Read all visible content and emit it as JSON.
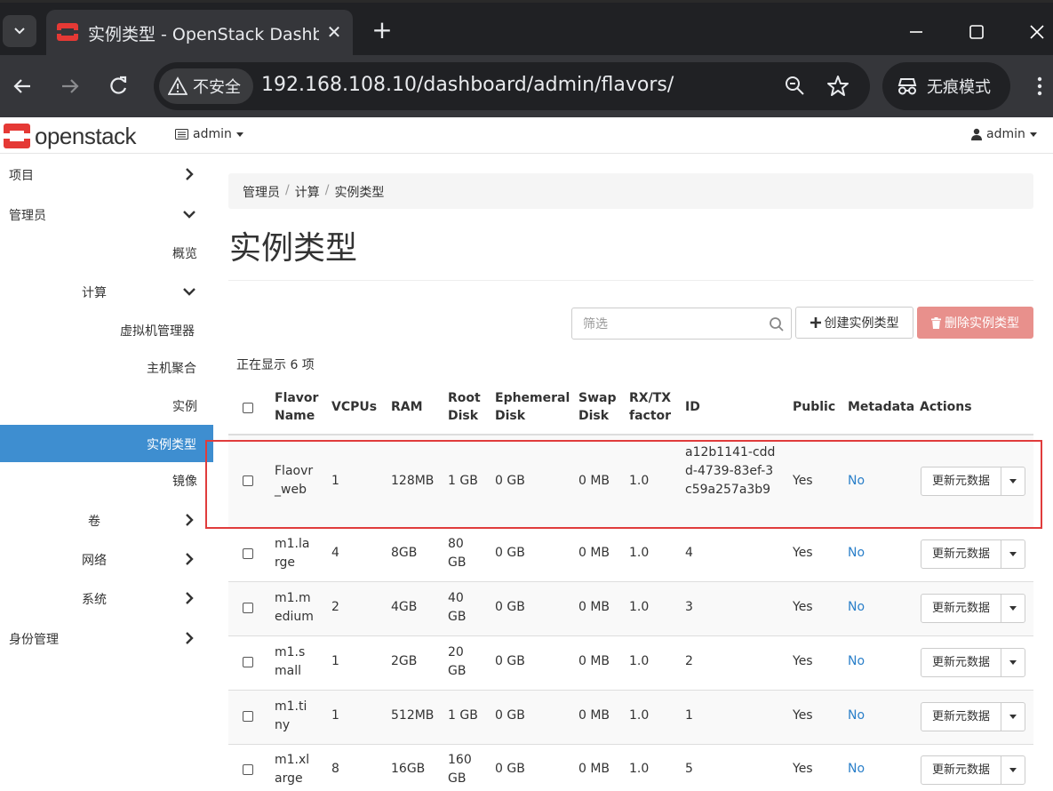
{
  "browser": {
    "tab_title": "实例类型 - OpenStack Dashboard",
    "security_label": "不安全",
    "url": "192.168.108.10/dashboard/admin/flavors/",
    "incognito_label": "无痕模式"
  },
  "header": {
    "logo_text": "openstack",
    "project_label": "admin",
    "user_label": "admin"
  },
  "sidebar": {
    "items": [
      {
        "label": "项目"
      },
      {
        "label": "管理员"
      },
      {
        "label": "概览"
      },
      {
        "label": "计算"
      },
      {
        "label": "虚拟机管理器"
      },
      {
        "label": "主机聚合"
      },
      {
        "label": "实例"
      },
      {
        "label": "实例类型"
      },
      {
        "label": "镜像"
      },
      {
        "label": "卷"
      },
      {
        "label": "网络"
      },
      {
        "label": "系统"
      },
      {
        "label": "身份管理"
      }
    ]
  },
  "breadcrumb": [
    "管理员",
    "计算",
    "实例类型"
  ],
  "page_title": "实例类型",
  "filter": {
    "placeholder": "筛选"
  },
  "buttons": {
    "create": "创建实例类型",
    "delete": "删除实例类型"
  },
  "count_text": "正在显示 6 项",
  "table": {
    "headers": [
      "Flavor Name",
      "VCPUs",
      "RAM",
      "Root Disk",
      "Ephemeral Disk",
      "Swap Disk",
      "RX/TX factor",
      "ID",
      "Public",
      "Metadata",
      "Actions"
    ],
    "rows": [
      {
        "name": "Flaovr_web",
        "vcpus": "1",
        "ram": "128MB",
        "root_disk": "1 GB",
        "ephemeral": "0 GB",
        "swap": "0 MB",
        "rxtx": "1.0",
        "id": "a12b1141-cddd-4739-83ef-3c59a257a3b9",
        "public": "Yes",
        "metadata": "No",
        "action": "更新元数据"
      },
      {
        "name": "m1.large",
        "vcpus": "4",
        "ram": "8GB",
        "root_disk": "80 GB",
        "ephemeral": "0 GB",
        "swap": "0 MB",
        "rxtx": "1.0",
        "id": "4",
        "public": "Yes",
        "metadata": "No",
        "action": "更新元数据"
      },
      {
        "name": "m1.medium",
        "vcpus": "2",
        "ram": "4GB",
        "root_disk": "40 GB",
        "ephemeral": "0 GB",
        "swap": "0 MB",
        "rxtx": "1.0",
        "id": "3",
        "public": "Yes",
        "metadata": "No",
        "action": "更新元数据"
      },
      {
        "name": "m1.small",
        "vcpus": "1",
        "ram": "2GB",
        "root_disk": "20 GB",
        "ephemeral": "0 GB",
        "swap": "0 MB",
        "rxtx": "1.0",
        "id": "2",
        "public": "Yes",
        "metadata": "No",
        "action": "更新元数据"
      },
      {
        "name": "m1.tiny",
        "vcpus": "1",
        "ram": "512MB",
        "root_disk": "1 GB",
        "ephemeral": "0 GB",
        "swap": "0 MB",
        "rxtx": "1.0",
        "id": "1",
        "public": "Yes",
        "metadata": "No",
        "action": "更新元数据"
      },
      {
        "name": "m1.xlarge",
        "vcpus": "8",
        "ram": "16GB",
        "root_disk": "160 GB",
        "ephemeral": "0 GB",
        "swap": "0 MB",
        "rxtx": "1.0",
        "id": "5",
        "public": "Yes",
        "metadata": "No",
        "action": "更新元数据"
      }
    ]
  },
  "colors": {
    "accent": "#3e8ed0",
    "danger": "#e8908c",
    "highlight": "#e03c3c",
    "link": "#2a7fc9"
  }
}
